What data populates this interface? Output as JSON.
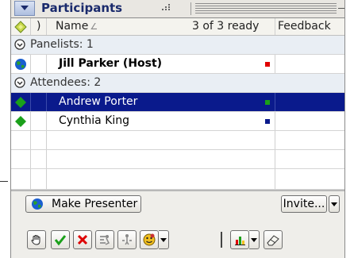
{
  "panel": {
    "title": "Participants"
  },
  "columns": {
    "name": "Name",
    "sort_indicator": "∠",
    "ready_status": "3 of 3 ready",
    "feedback": "Feedback"
  },
  "groups": [
    {
      "label": "Panelists: 1",
      "members": [
        {
          "name": "Jill Parker (Host)",
          "status_color": "#e00000",
          "icon": "globe-icon"
        }
      ]
    },
    {
      "label": "Attendees: 2",
      "members": [
        {
          "name": "Andrew Porter",
          "status_color": "#1aa01a",
          "icon": "green-diamond-icon",
          "selected": true
        },
        {
          "name": "Cynthia King",
          "status_color": "#0a1a8c",
          "icon": "green-diamond-icon"
        }
      ]
    }
  ],
  "buttons": {
    "make_presenter": "Make Presenter",
    "invite": "Invite..."
  },
  "toolbar": [
    "raise-hand-icon",
    "checkmark-icon",
    "x-mark-icon",
    "speed-up-icon",
    "slow-down-icon",
    "emoticon-icon",
    "poll-chart-icon",
    "eraser-icon"
  ],
  "colors": {
    "selection": "#0a1a8c",
    "title_text": "#1a2a6c"
  }
}
